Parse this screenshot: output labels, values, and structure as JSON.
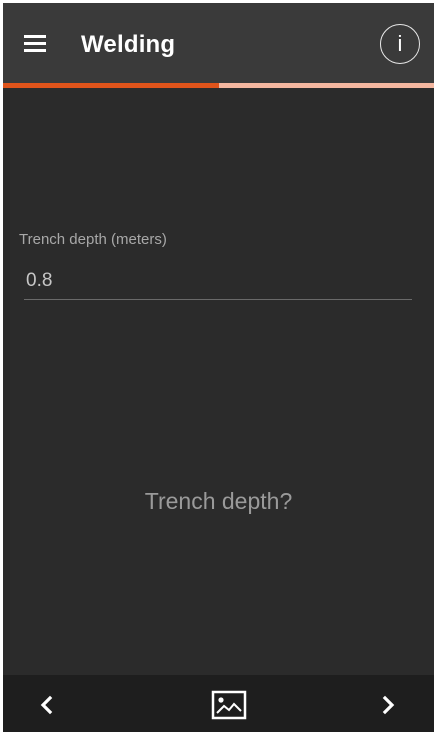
{
  "app_bar": {
    "title": "Welding",
    "menu_icon": "hamburger-menu-icon",
    "info_icon": "info-icon",
    "info_glyph": "i"
  },
  "progress": {
    "fraction": 0.5,
    "fill_color": "#e0541b",
    "track_color": "#f4b7a0"
  },
  "form": {
    "label": "Trench depth (meters)",
    "value": "0.8"
  },
  "question": "Trench depth?",
  "bottom_nav": {
    "prev_icon": "chevron-left-icon",
    "gallery_icon": "image-icon",
    "next_icon": "chevron-right-icon"
  }
}
